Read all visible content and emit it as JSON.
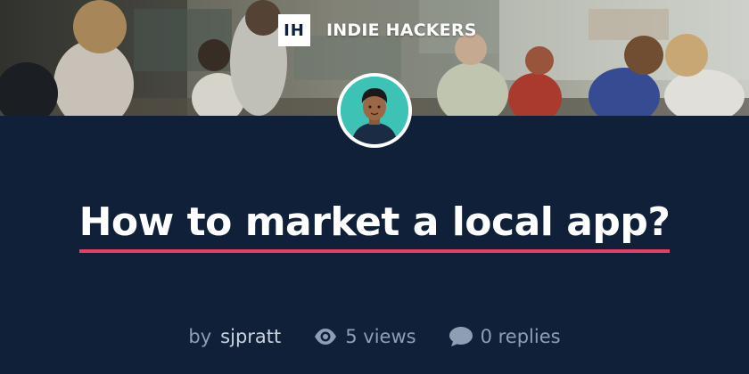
{
  "brand": {
    "logo_text": "IH",
    "name": "INDIE HACKERS"
  },
  "post": {
    "title": "How to market a local app?",
    "by_label": "by",
    "author": "sjpratt",
    "views": "5 views",
    "replies": "0 replies"
  },
  "colors": {
    "background": "#0f2038",
    "underline_accent": "#e63f66",
    "avatar_bg": "#3cc3b6",
    "meta_text": "#8e9eb3"
  },
  "icons": {
    "views": "eye-icon",
    "replies": "speech-bubble-icon"
  }
}
